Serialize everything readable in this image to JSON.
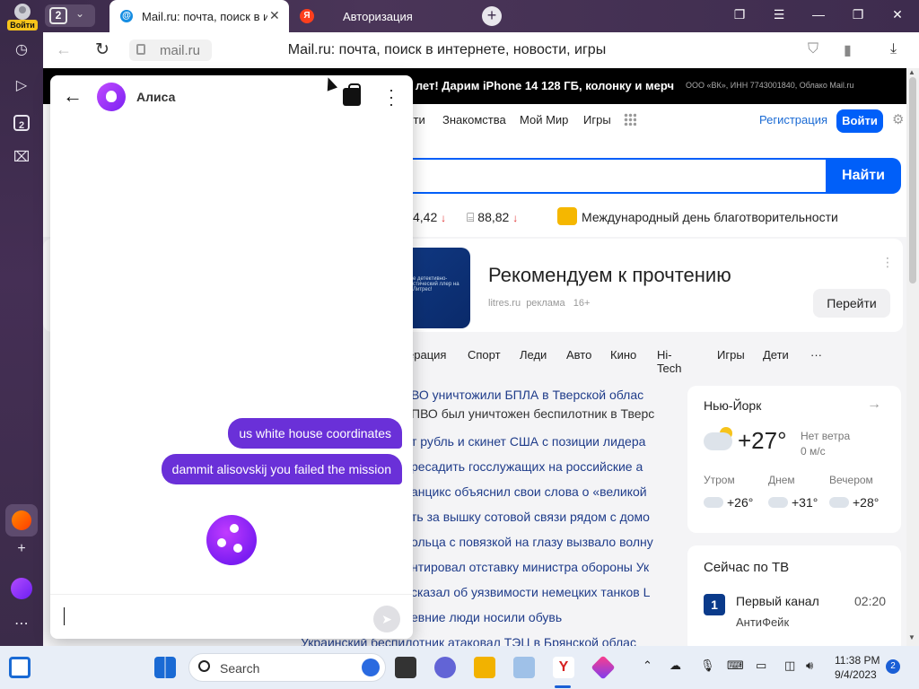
{
  "browser": {
    "profile_label": "Войти",
    "tab_count": "2",
    "tabs": [
      {
        "title": "Mail.ru: почта, поиск в и"
      },
      {
        "title": "Авторизация",
        "favicon": "Я"
      }
    ],
    "url": "mail.ru",
    "page_title": "Mail.ru: почта, поиск в интернете, новости, игры",
    "badge_count": "2"
  },
  "sidebar": {
    "tab_count": "2"
  },
  "mailru": {
    "banner": "0 лет! Дарим iPhone 14 128 ГБ, колонку и мерч",
    "banner_legal": "ООО «ВК», ИНН 7743001840, Облако Mail.ru",
    "nav": [
      "сти",
      "Знакомства",
      "Мой Мир",
      "Игры"
    ],
    "register": "Регистрация",
    "login": "Войти",
    "search_button": "Найти",
    "rates": {
      "usd": "4,42",
      "eur": "88,82"
    },
    "holiday": "Международный день благотворительности",
    "ad": {
      "headline": "Рекомендуем к прочтению",
      "image_text": "е детективно-стический ллер на Литрес!",
      "source": "litres.ru",
      "tag": "реклама",
      "age": "16+",
      "button": "Перейти"
    },
    "categories": [
      "ерация",
      "Спорт",
      "Леди",
      "Авто",
      "Кино",
      "Hi-Tech",
      "Игры",
      "Дети"
    ],
    "news": [
      {
        "text": "ВО уничтожили БПЛА в Тверской облас",
        "style": "link"
      },
      {
        "text": "ПВО был уничтожен беспилотник в Тверс",
        "style": "plain"
      },
      {
        "text": "т рубль и скинет США с позиции лидера",
        "style": "link"
      },
      {
        "text": "ресадить госслужащих на российские а",
        "style": "link"
      },
      {
        "text": "анцикс объяснил свои слова о «великой",
        "style": "link"
      },
      {
        "text": "ть за вышку сотовой связи рядом с домо",
        "style": "link"
      },
      {
        "text": "ольца с повязкой на глазу вызвало волну",
        "style": "link"
      },
      {
        "text": "нтировал отставку министра обороны Ук",
        "style": "link"
      },
      {
        "text": "сказал об уязвимости немецких танков L",
        "style": "link"
      },
      {
        "text": "евние люди носили обувь",
        "style": "link"
      },
      {
        "text": "Украинский беспилотник атаковал ТЭЦ в Брянской облас",
        "style": "link"
      }
    ],
    "weather": {
      "city": "Нью-Йорк",
      "temp": "+27°",
      "wind": "Нет ветра",
      "wind_speed": "0 м/с",
      "periods": [
        {
          "label": "Утром",
          "temp": "+26°"
        },
        {
          "label": "Днем",
          "temp": "+31°"
        },
        {
          "label": "Вечером",
          "temp": "+28°"
        }
      ]
    },
    "tv": {
      "heading": "Сейчас по ТВ",
      "channel": "Первый канал",
      "time": "02:20",
      "show": "АнтиФейк"
    }
  },
  "alice": {
    "name": "Алиса",
    "messages": [
      "us white house coordinates",
      "dammit alisovskij you failed the mission"
    ]
  },
  "taskbar": {
    "search_label": "Search",
    "time": "11:38 PM",
    "date": "9/4/2023",
    "notifications": "2"
  }
}
